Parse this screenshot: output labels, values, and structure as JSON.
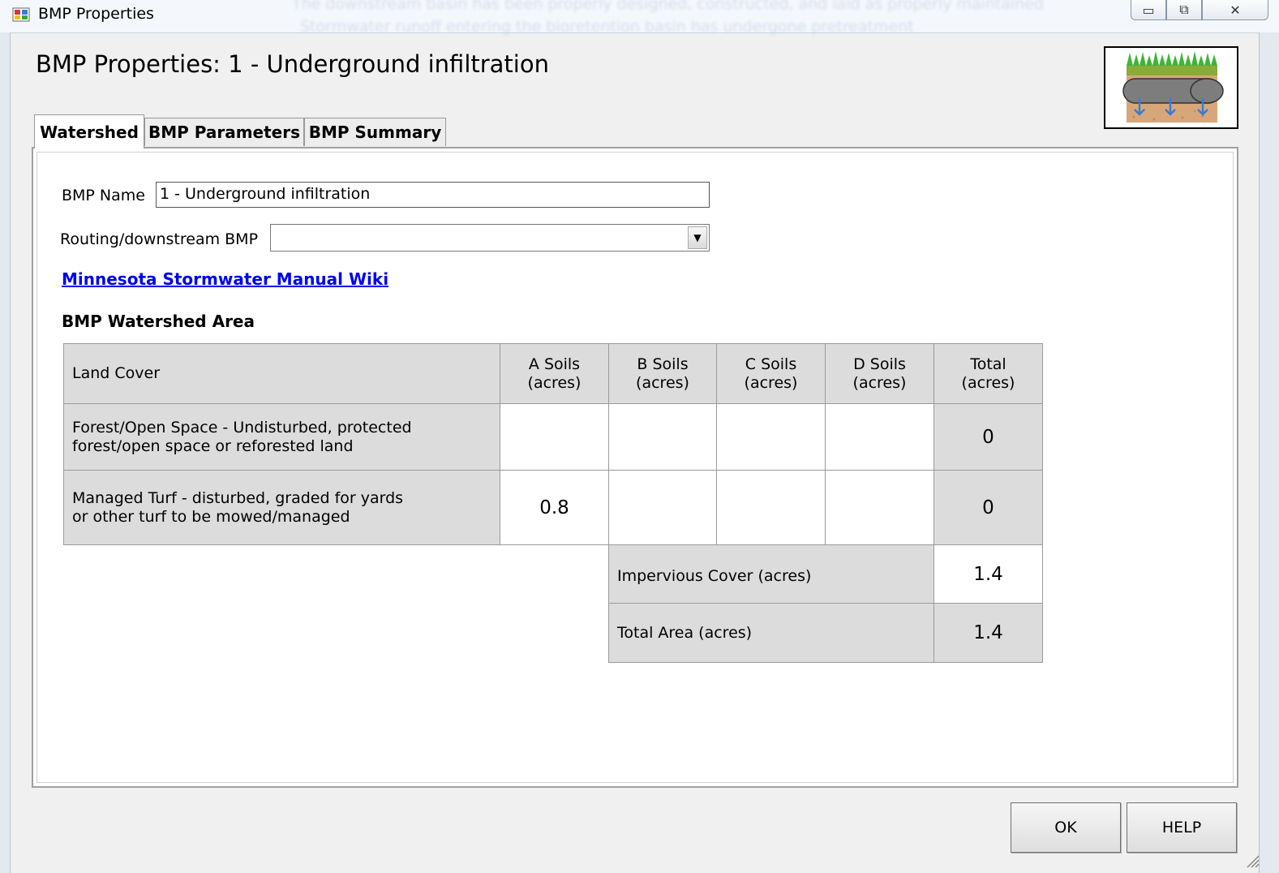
{
  "window": {
    "title": "BMP Properties",
    "background_text_1": "The downstream basin has been properly designed, constructed, and laid as properly maintained",
    "background_text_2": "Stormwater runoff entering the bioretention basin has undergone pretreatment",
    "controls": [
      "minimize-icon",
      "restore-icon",
      "close-icon"
    ],
    "minimize_glyph": "▭",
    "restore_glyph": "⧉",
    "close_glyph": "✕"
  },
  "heading": "BMP Properties: 1 - Underground infiltration",
  "illustration": "underground-infiltration-icon",
  "tabs": [
    {
      "label": "Watershed",
      "active": true
    },
    {
      "label": "BMP Parameters",
      "active": false
    },
    {
      "label": "BMP Summary",
      "active": false
    }
  ],
  "form": {
    "bmp_name_label": "BMP Name",
    "bmp_name_value": "1 - Underground infiltration",
    "routing_label": "Routing/downstream BMP",
    "routing_value": "",
    "dropdown_glyph": "▼",
    "wiki_link": "Minnesota Stormwater Manual Wiki"
  },
  "watershed": {
    "section_title": "BMP Watershed Area",
    "headers": {
      "land_cover": "Land Cover",
      "a_line1": "A Soils",
      "a_line2": "(acres)",
      "b_line1": "B Soils",
      "b_line2": "(acres)",
      "c_line1": "C Soils",
      "c_line2": "(acres)",
      "d_line1": "D Soils",
      "d_line2": "(acres)",
      "total_line1": "Total",
      "total_line2": "(acres)"
    },
    "rows": [
      {
        "line1": "Forest/Open Space - Undisturbed, protected",
        "line2": "forest/open space or reforested land",
        "a": "",
        "b": "",
        "c": "",
        "d": "",
        "total": "0"
      },
      {
        "line1": "Managed Turf - disturbed, graded for yards",
        "line2": "or other turf to be mowed/managed",
        "a": "0.8",
        "b": "",
        "c": "",
        "d": "",
        "total": "0"
      }
    ],
    "impervious_label": "Impervious Cover (acres)",
    "impervious_value": "1.4",
    "total_area_label": "Total Area (acres)",
    "total_area_value": "1.4"
  },
  "buttons": {
    "ok": "OK",
    "help": "HELP"
  },
  "colors": {
    "header_gray": "#dcdcdc",
    "link": "#0000ee"
  }
}
